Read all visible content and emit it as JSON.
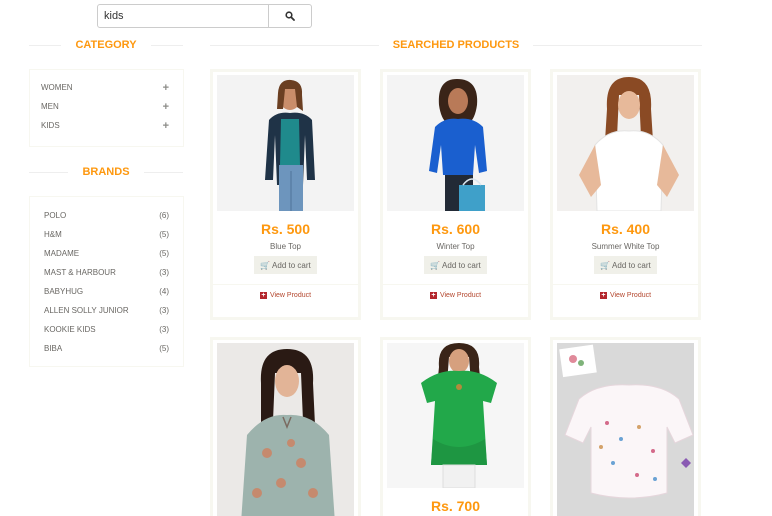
{
  "search": {
    "value": "kids",
    "placeholder": "Search"
  },
  "sections": {
    "category_title": "CATEGORY",
    "brands_title": "BRANDS",
    "products_title": "SEARCHED PRODUCTS"
  },
  "categories": [
    {
      "label": "WOMEN",
      "expand": "+"
    },
    {
      "label": "MEN",
      "expand": "+"
    },
    {
      "label": "KIDS",
      "expand": "+"
    }
  ],
  "brands": [
    {
      "name": "POLO",
      "count": "(6)"
    },
    {
      "name": "H&M",
      "count": "(5)"
    },
    {
      "name": "MADAME",
      "count": "(5)"
    },
    {
      "name": "MAST & HARBOUR",
      "count": "(3)"
    },
    {
      "name": "BABYHUG",
      "count": "(4)"
    },
    {
      "name": "ALLEN SOLLY JUNIOR",
      "count": "(3)"
    },
    {
      "name": "KOOKIE KIDS",
      "count": "(3)"
    },
    {
      "name": "BIBA",
      "count": "(5)"
    }
  ],
  "products": [
    {
      "price": "Rs. 500",
      "name": "Blue Top",
      "cart": "Add to cart",
      "view": "View Product"
    },
    {
      "price": "Rs. 600",
      "name": "Winter Top",
      "cart": "Add to cart",
      "view": "View Product"
    },
    {
      "price": "Rs. 400",
      "name": "Summer White Top",
      "cart": "Add to cart",
      "view": "View Product"
    },
    {
      "price": "",
      "name": "",
      "cart": "",
      "view": ""
    },
    {
      "price": "Rs. 700",
      "name": "",
      "cart": "",
      "view": ""
    },
    {
      "price": "",
      "name": "",
      "cart": "",
      "view": ""
    }
  ],
  "colors": {
    "accent": "#fe980f",
    "link": "#b3262d",
    "border": "#f7f7f0"
  }
}
